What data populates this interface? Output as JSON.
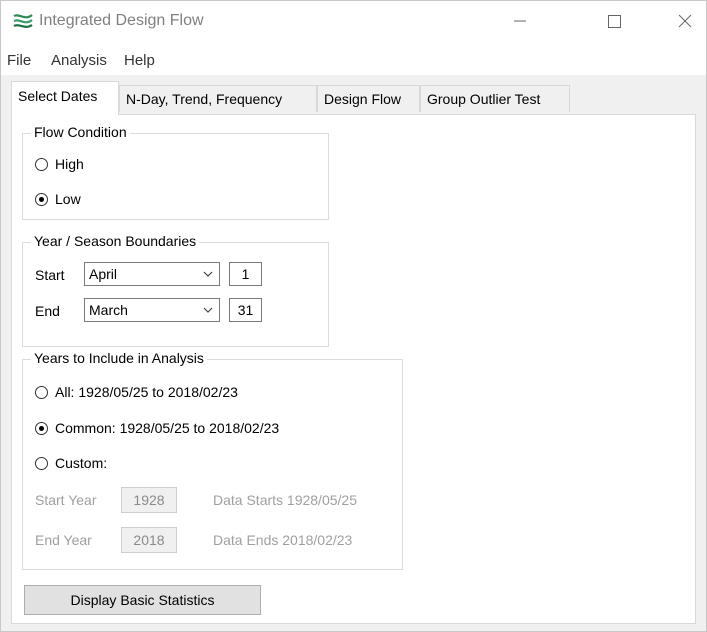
{
  "window": {
    "title": "Integrated Design Flow"
  },
  "menu": {
    "items": [
      "File",
      "Analysis",
      "Help"
    ]
  },
  "tabs": [
    {
      "label": "Select Dates",
      "active": true
    },
    {
      "label": "N-Day, Trend, Frequency",
      "active": false
    },
    {
      "label": "Design Flow",
      "active": false
    },
    {
      "label": "Group Outlier Test",
      "active": false
    }
  ],
  "flow_condition": {
    "label": "Flow Condition",
    "options": [
      "High",
      "Low"
    ],
    "selected": "Low"
  },
  "boundaries": {
    "label": "Year / Season Boundaries",
    "start_label": "Start",
    "start_month": "April",
    "start_day": "1",
    "end_label": "End",
    "end_month": "March",
    "end_day": "31"
  },
  "years": {
    "label": "Years to Include in Analysis",
    "option_all": "All: 1928/05/25 to 2018/02/23",
    "option_common": "Common: 1928/05/25 to 2018/02/23",
    "option_custom": "Custom:",
    "selected": "Common",
    "start_year_label": "Start Year",
    "start_year_value": "1928",
    "data_starts": "Data Starts 1928/05/25",
    "end_year_label": "End Year",
    "end_year_value": "2018",
    "data_ends": "Data Ends 2018/02/23"
  },
  "actions": {
    "display_stats_label": "Display Basic Statistics"
  },
  "colors": {
    "icon_green": "#2e8b57",
    "disabled_text": "#a0a0a0"
  }
}
